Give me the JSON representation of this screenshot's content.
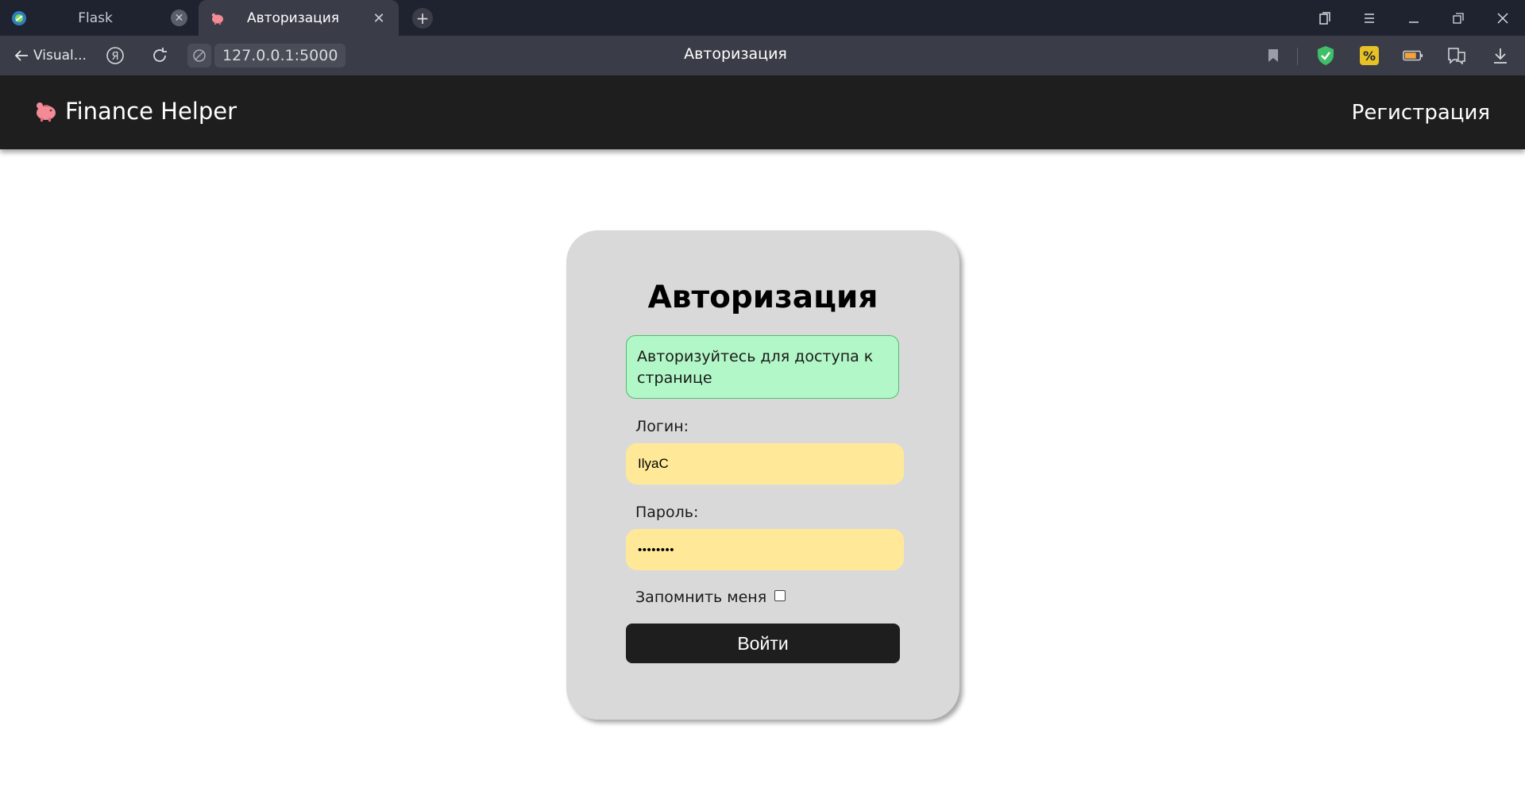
{
  "browser": {
    "tabs": [
      {
        "label": "Flask",
        "active": false
      },
      {
        "label": "Авторизация",
        "active": true
      }
    ],
    "back_label": "Visual...",
    "url": "127.0.0.1:5000",
    "page_title": "Авторизация",
    "colors": {
      "accent_green": "#3fbf6a",
      "accent_yellow": "#e6c227"
    }
  },
  "site": {
    "brand": "Finance Helper",
    "brand_icon": "piggy-bank-icon",
    "nav": {
      "register": "Регистрация"
    }
  },
  "login": {
    "heading": "Авторизация",
    "flash": "Авторизуйтесь для доступа к странице",
    "login_label": "Логин:",
    "login_value": "IlyaC",
    "password_label": "Пароль:",
    "password_value": "••••••••",
    "remember_label": "Запомнить меня",
    "remember_checked": false,
    "submit_label": "Войти",
    "colors": {
      "card": "#d9d9d9",
      "flash_bg": "#b2f7c7",
      "input_bg": "#ffe999",
      "button_bg": "#1e1e1e"
    }
  }
}
